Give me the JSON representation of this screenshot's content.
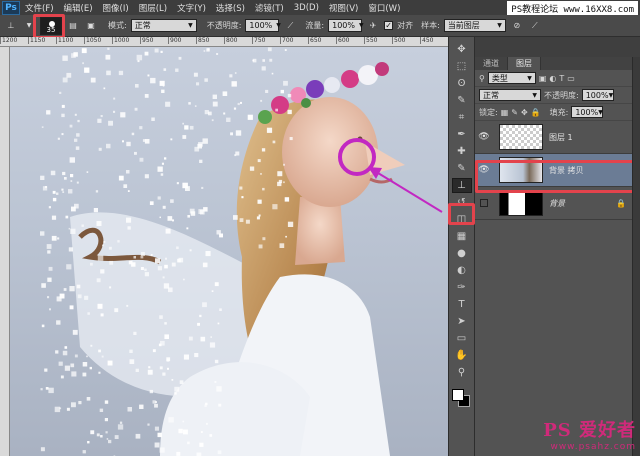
{
  "menubar": {
    "logo": "Ps",
    "items": [
      "文件(F)",
      "编辑(E)",
      "图像(I)",
      "图层(L)",
      "文字(Y)",
      "选择(S)",
      "滤镜(T)",
      "3D(D)",
      "视图(V)",
      "窗口(W)"
    ],
    "watermark": "PS教程论坛 www.16XX8.com"
  },
  "options": {
    "brush_size": "35",
    "mode_label": "模式:",
    "mode_value": "正常",
    "opacity_label": "不透明度:",
    "opacity_value": "100%",
    "flow_label": "流量:",
    "flow_value": "100%",
    "align_label": "对齐",
    "sample_label": "样本:",
    "sample_value": "当前图层"
  },
  "ruler": [
    "1200",
    "1150",
    "1100",
    "1050",
    "1000",
    "950",
    "900",
    "850",
    "800",
    "750",
    "700",
    "650",
    "600",
    "550",
    "500",
    "450"
  ],
  "toolbar": {
    "tools": [
      "move-tool",
      "marquee-tool",
      "lasso-tool",
      "quick-select-tool",
      "crop-tool",
      "eyedropper-tool",
      "healing-tool",
      "brush-tool",
      "clone-stamp-tool",
      "history-brush-tool",
      "eraser-tool",
      "gradient-tool",
      "blur-tool",
      "dodge-tool",
      "pen-tool",
      "type-tool",
      "path-select-tool",
      "shape-tool",
      "hand-tool",
      "zoom-tool"
    ],
    "glyphs": [
      "✥",
      "⬚",
      "ʘ",
      "✎",
      "⌗",
      "✒",
      "✚",
      "✎",
      "⊥",
      "↺",
      "◫",
      "▦",
      "●",
      "◐",
      "✑",
      "T",
      "➤",
      "▭",
      "✋",
      "⚲"
    ]
  },
  "layers_panel": {
    "tabs": [
      "通道",
      "图层"
    ],
    "filter_value": "类型",
    "blend_value": "正常",
    "opacity_label": "不透明度:",
    "opacity_value": "100%",
    "lock_label": "锁定:",
    "fill_label": "填充:",
    "fill_value": "100%",
    "layers": [
      {
        "name": "图层 1",
        "visible": true,
        "selected": false
      },
      {
        "name": "背景 拷贝",
        "visible": true,
        "selected": true
      },
      {
        "name": "背景",
        "visible": false,
        "selected": false,
        "locked": true
      }
    ]
  },
  "bottom_watermark": {
    "brand": "PS 爱好者",
    "url": "www.psahz.com"
  },
  "colors": {
    "highlight": "#e3434c",
    "annotation": "#c228c2",
    "layer_selected": "#6b7c95"
  }
}
